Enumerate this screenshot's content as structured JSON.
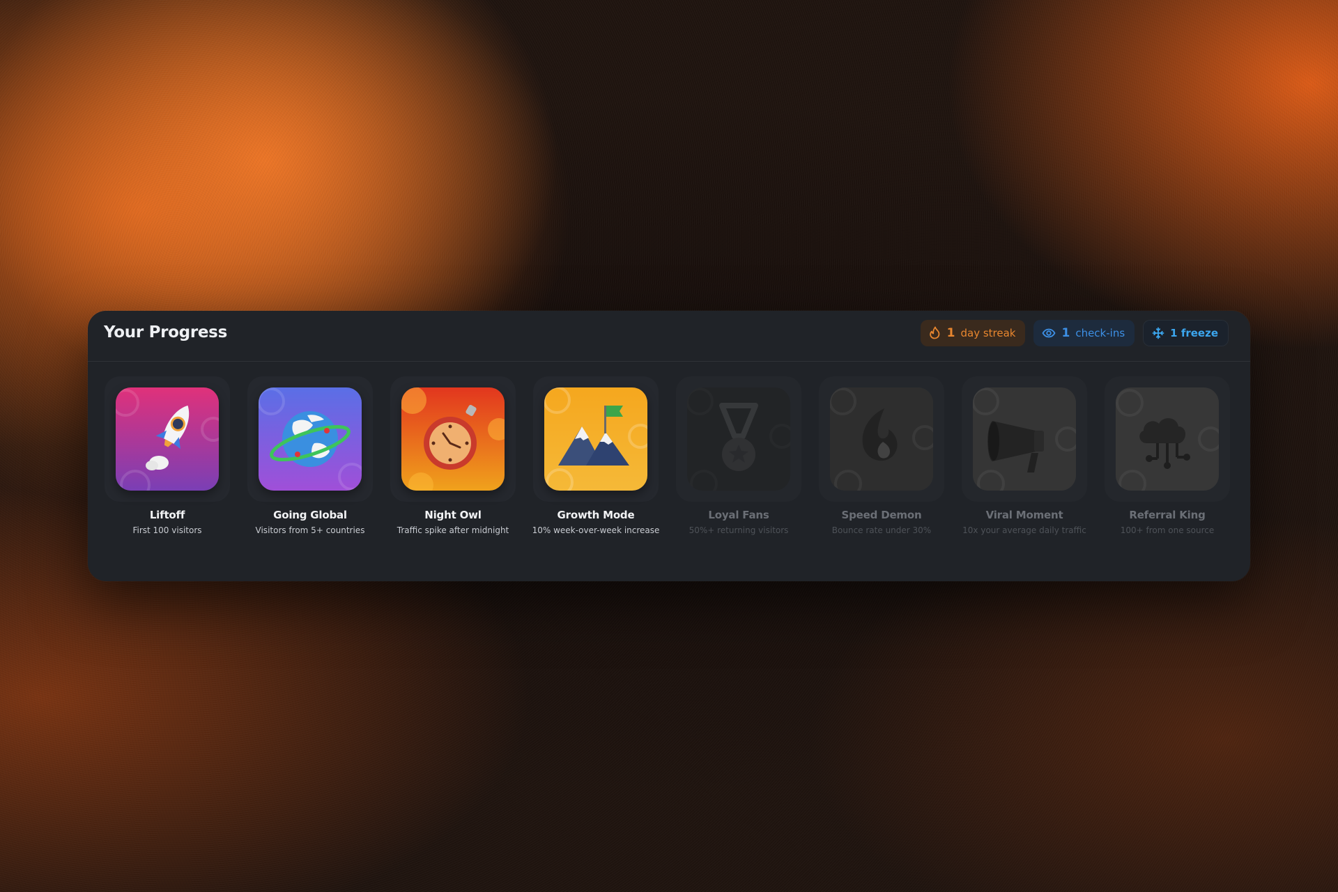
{
  "header": {
    "title": "Your Progress"
  },
  "stats": {
    "streak": {
      "count": "1",
      "label": "day streak",
      "icon": "flame-icon",
      "color": "#e8862f"
    },
    "checkins": {
      "count": "1",
      "label": "check-ins",
      "icon": "eye-icon",
      "color": "#3d90e6"
    },
    "freeze": {
      "label": "1 freeze",
      "icon": "snowflake-icon",
      "color": "#3ca6ee"
    }
  },
  "achievements": [
    {
      "name": "Liftoff",
      "desc": "First 100 visitors",
      "icon": "rocket-icon",
      "unlocked": true
    },
    {
      "name": "Going Global",
      "desc": "Visitors from 5+ countries",
      "icon": "globe-icon",
      "unlocked": true
    },
    {
      "name": "Night Owl",
      "desc": "Traffic spike after midnight",
      "icon": "stopwatch-icon",
      "unlocked": true
    },
    {
      "name": "Growth Mode",
      "desc": "10% week-over-week increase",
      "icon": "mountain-flag-icon",
      "unlocked": true
    },
    {
      "name": "Loyal Fans",
      "desc": "50%+ returning visitors",
      "icon": "medal-icon",
      "unlocked": false
    },
    {
      "name": "Speed Demon",
      "desc": "Bounce rate under 30%",
      "icon": "flame-drop-icon",
      "unlocked": false
    },
    {
      "name": "Viral Moment",
      "desc": "10x your average daily traffic",
      "icon": "megaphone-icon",
      "unlocked": false
    },
    {
      "name": "Referral King",
      "desc": "100+ from one source",
      "icon": "cloud-network-icon",
      "unlocked": false
    }
  ]
}
